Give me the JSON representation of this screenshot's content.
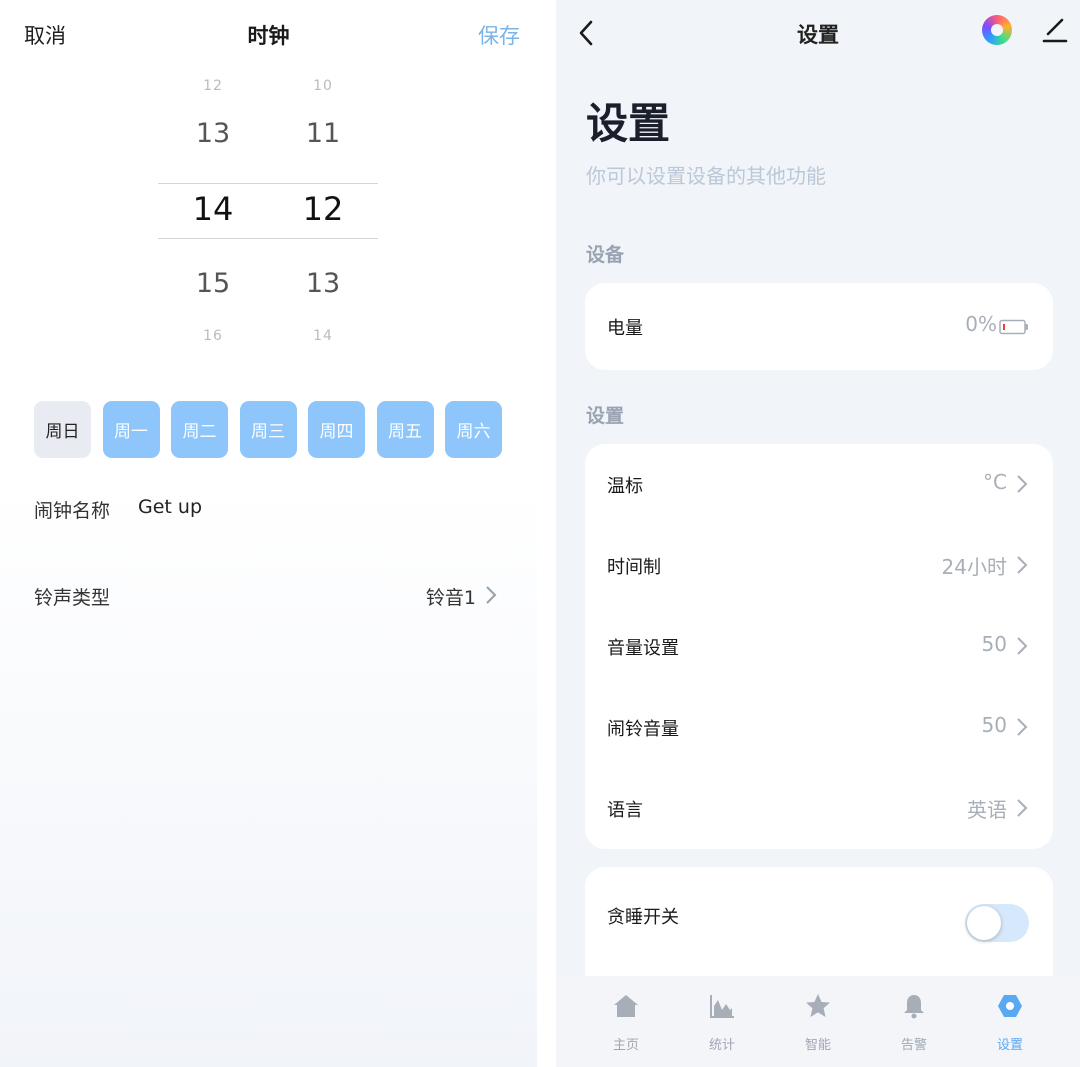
{
  "left": {
    "header": {
      "cancel": "取消",
      "title": "时钟",
      "save": "保存"
    },
    "picker": {
      "hours": [
        "12",
        "13",
        "14",
        "15",
        "16"
      ],
      "minutes": [
        "10",
        "11",
        "12",
        "13",
        "14"
      ]
    },
    "days": [
      {
        "label": "周日",
        "selected": false
      },
      {
        "label": "周一",
        "selected": true
      },
      {
        "label": "周二",
        "selected": true
      },
      {
        "label": "周三",
        "selected": true
      },
      {
        "label": "周四",
        "selected": true
      },
      {
        "label": "周五",
        "selected": true
      },
      {
        "label": "周六",
        "selected": true
      }
    ],
    "alarm_name": {
      "label": "闹钟名称",
      "value": "Get up"
    },
    "ringtone": {
      "label": "铃声类型",
      "value": "铃音1"
    }
  },
  "right": {
    "header": {
      "title": "设置"
    },
    "page_title": "设置",
    "subtitle": "你可以设置设备的其他功能",
    "section_device": "设备",
    "battery": {
      "label": "电量",
      "value": "0%"
    },
    "section_settings": "设置",
    "settings": [
      {
        "label": "温标",
        "value": "°C"
      },
      {
        "label": "时间制",
        "value": "24小时"
      },
      {
        "label": "音量设置",
        "value": "50"
      },
      {
        "label": "闹铃音量",
        "value": "50"
      },
      {
        "label": "语言",
        "value": "英语"
      }
    ],
    "snooze": {
      "label": "贪睡开关",
      "on": false
    },
    "tabs": [
      {
        "label": "主页",
        "icon": "home-icon",
        "active": false
      },
      {
        "label": "统计",
        "icon": "stats-icon",
        "active": false
      },
      {
        "label": "智能",
        "icon": "star-icon",
        "active": false
      },
      {
        "label": "告警",
        "icon": "bell-icon",
        "active": false
      },
      {
        "label": "设置",
        "icon": "settings-hex-icon",
        "active": true
      }
    ]
  },
  "colors": {
    "accent": "#8ec5fb",
    "save": "#7bb3e6",
    "tab_active": "#5aa8f2",
    "toggle_track": "#d6e8fb"
  }
}
